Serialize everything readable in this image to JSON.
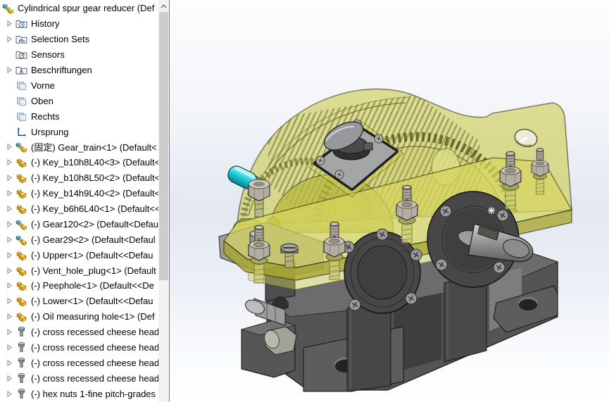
{
  "tree": {
    "items": [
      {
        "label": "Cylindrical spur gear reducer  (Def",
        "icon": "assembly",
        "arrow": false,
        "top": true
      },
      {
        "label": "History",
        "icon": "history",
        "arrow": true
      },
      {
        "label": "Selection Sets",
        "icon": "selection-sets",
        "arrow": true
      },
      {
        "label": "Sensors",
        "icon": "sensors",
        "arrow": false
      },
      {
        "label": "Beschriftungen",
        "icon": "annotations",
        "arrow": true
      },
      {
        "label": "Vorne",
        "icon": "plane",
        "arrow": false
      },
      {
        "label": "Oben",
        "icon": "plane",
        "arrow": false
      },
      {
        "label": "Rechts",
        "icon": "plane",
        "arrow": false
      },
      {
        "label": "Ursprung",
        "icon": "origin",
        "arrow": false
      },
      {
        "label": "(固定) Gear_train<1> (Default<",
        "icon": "assembly",
        "arrow": true
      },
      {
        "label": "(-) Key_b10h8L40<3> (Default<",
        "icon": "part",
        "arrow": true
      },
      {
        "label": "(-) Key_b10h8L50<2> (Default<",
        "icon": "part",
        "arrow": true
      },
      {
        "label": "(-) Key_b14h9L40<2> (Default<",
        "icon": "part",
        "arrow": true
      },
      {
        "label": "(-) Key_b6h6L40<1> (Default<<",
        "icon": "part",
        "arrow": true
      },
      {
        "label": "(-) Gear120<2> (Default<Defau",
        "icon": "assembly",
        "arrow": true
      },
      {
        "label": "(-) Gear29<2> (Default<Defaul",
        "icon": "assembly",
        "arrow": true
      },
      {
        "label": "(-) Upper<1> (Default<<Defau",
        "icon": "part",
        "arrow": true
      },
      {
        "label": "(-) Vent_hole_plug<1> (Default",
        "icon": "part",
        "arrow": true
      },
      {
        "label": "(-) Peephole<1> (Default<<De",
        "icon": "part",
        "arrow": true
      },
      {
        "label": "(-) Lower<1> (Default<<Defau",
        "icon": "part",
        "arrow": true
      },
      {
        "label": "(-) Oil measuring hole<1> (Def",
        "icon": "part",
        "arrow": true
      },
      {
        "label": "(-) cross recessed cheese head",
        "icon": "screw",
        "arrow": true
      },
      {
        "label": "(-) cross recessed cheese head",
        "icon": "screw",
        "arrow": true
      },
      {
        "label": "(-) cross recessed cheese head",
        "icon": "screw",
        "arrow": true
      },
      {
        "label": "(-) cross recessed cheese head",
        "icon": "screw",
        "arrow": true
      },
      {
        "label": "(-) hex nuts 1-fine pitch-grades",
        "icon": "screw",
        "arrow": true
      }
    ]
  },
  "viewport": {
    "model_name": "Cylindrical spur gear reducer"
  },
  "colors": {
    "housing": "#cdcd52",
    "housing-dark": "#a8a832",
    "housing-line": "#3a3a10",
    "base": "#545454",
    "base-light": "#6c6c6c",
    "base-dark": "#3e3e3e",
    "flange": "#474747",
    "steel": "#b2aea4",
    "cyan": "#25d6e0",
    "cover": "#a4a5a7",
    "knob": "#97989a"
  }
}
